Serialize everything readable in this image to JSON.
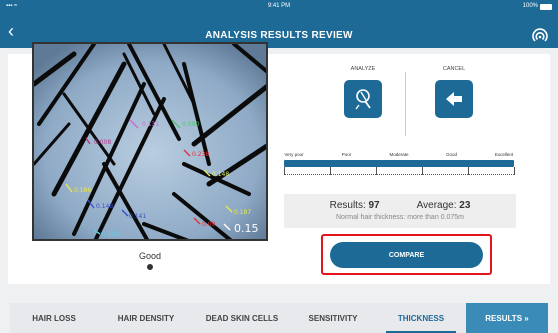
{
  "status_bar": {
    "signal": "▪▪▪ ≈",
    "time": "9:41 PM",
    "battery": "100%"
  },
  "header": {
    "title": "ANALYSIS RESULTS REVIEW",
    "back_icon": "chevron-left-icon",
    "nfc_icon": "nfc-signal-icon"
  },
  "image": {
    "rating": "Good",
    "measurements": [
      {
        "label": "0.131",
        "color": "#c86cd6"
      },
      {
        "label": "0.090",
        "color": "#55c27a"
      },
      {
        "label": "0.008",
        "color": "#b03a8a"
      },
      {
        "label": "0.238",
        "color": "#e0323a"
      },
      {
        "label": "0.148",
        "color": "#d8f06a"
      },
      {
        "label": "0.186",
        "color": "#e8e84a"
      },
      {
        "label": "0.148",
        "color": "#3a4fc8"
      },
      {
        "label": "0.141",
        "color": "#3a4fc8"
      },
      {
        "label": "0.187",
        "color": "#e8e84a"
      },
      {
        "label": "0.09",
        "color": "#e0323a"
      },
      {
        "label": "0.15",
        "color": "#ffffff"
      },
      {
        "label": "0.132",
        "color": "#5ad0e8"
      }
    ]
  },
  "actions": {
    "analyze_label": "ANALYZE",
    "cancel_label": "CANCEL"
  },
  "scale": {
    "labels": [
      "Very poor",
      "Poor",
      "Moderate",
      "Good",
      "Excellent"
    ],
    "marker_level": 1.0
  },
  "results": {
    "results_label": "Results:",
    "results_value": "97",
    "average_label": "Average:",
    "average_value": "23",
    "note": "Normal hair thickness: more than 0.075m"
  },
  "compare_label": "COMPARE",
  "tabs": [
    {
      "label": "HAIR LOSS"
    },
    {
      "label": "HAIR DENSITY"
    },
    {
      "label": "DEAD SKIN CELLS"
    },
    {
      "label": "SENSITIVITY"
    },
    {
      "label": "THICKNESS",
      "active": true
    },
    {
      "label": "RESULTS »"
    }
  ],
  "colors": {
    "primary": "#1d6a97",
    "highlight": "#e3141c",
    "results_tab": "#3a8bb8"
  }
}
